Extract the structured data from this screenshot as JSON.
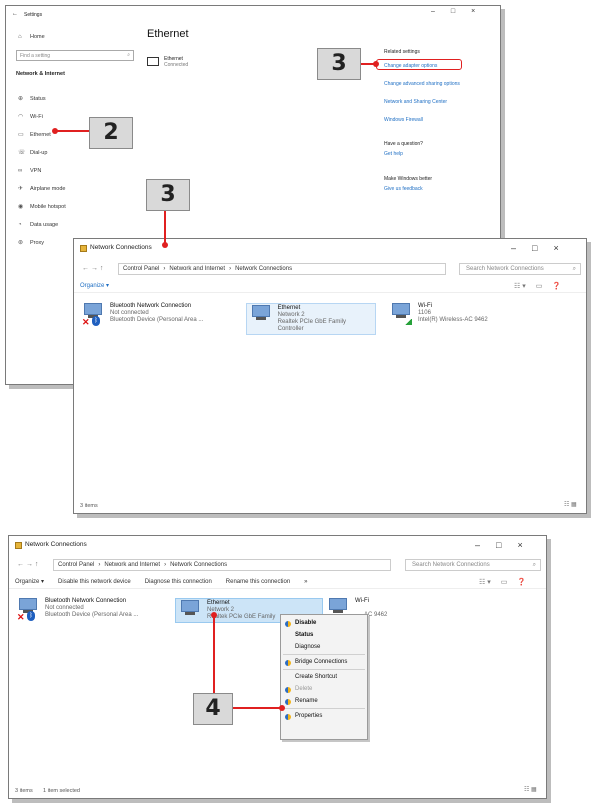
{
  "settings": {
    "title": "Settings",
    "back_glyph": "←",
    "home": "Home",
    "search_placeholder": "Find a setting",
    "section": "Network & Internet",
    "nav": [
      {
        "label": "Status",
        "icon": "status-icon"
      },
      {
        "label": "Wi-Fi",
        "icon": "wifi-icon"
      },
      {
        "label": "Ethernet",
        "icon": "ethernet-icon"
      },
      {
        "label": "Dial-up",
        "icon": "dialup-icon"
      },
      {
        "label": "VPN",
        "icon": "vpn-icon"
      },
      {
        "label": "Airplane mode",
        "icon": "airplane-icon"
      },
      {
        "label": "Mobile hotspot",
        "icon": "hotspot-icon"
      },
      {
        "label": "Data usage",
        "icon": "data-usage-icon"
      },
      {
        "label": "Proxy",
        "icon": "proxy-icon"
      }
    ],
    "page_title": "Ethernet",
    "adapter_name": "Ethernet",
    "adapter_status": "Connected",
    "related_heading": "Related settings",
    "related_links": [
      "Change adapter options",
      "Change advanced sharing options",
      "Network and Sharing Center",
      "Windows Firewall"
    ],
    "question_heading": "Have a question?",
    "question_link": "Get help",
    "better_heading": "Make Windows better",
    "better_link": "Give us feedback",
    "window_controls": [
      "–",
      "□",
      "×"
    ]
  },
  "netconn1": {
    "title": "Network Connections",
    "breadcrumb": [
      "Control Panel",
      "Network and Internet",
      "Network Connections"
    ],
    "nav_glyphs": "←  →  ↑",
    "search_placeholder": "Search Network Connections",
    "organize": "Organize ▾",
    "window_controls": [
      "–",
      "□",
      "×"
    ],
    "items": [
      {
        "name": "Bluetooth Network Connection",
        "line2": "Not connected",
        "line3": "Bluetooth Device (Personal Area ..."
      },
      {
        "name": "Ethernet",
        "line2": "Network 2",
        "line3": "Realtek PCIe GbE Family Controller"
      },
      {
        "name": "Wi-Fi",
        "line2": "1106",
        "line3": "Intel(R) Wireless-AC 9462"
      }
    ],
    "status": "3 items"
  },
  "netconn2": {
    "title": "Network Connections",
    "breadcrumb": [
      "Control Panel",
      "Network and Internet",
      "Network Connections"
    ],
    "nav_glyphs": "←  →  ↑",
    "search_placeholder": "Search Network Connections",
    "toolbar": [
      "Organize ▾",
      "Disable this network device",
      "Diagnose this connection",
      "Rename this connection",
      "»"
    ],
    "window_controls": [
      "–",
      "□",
      "×"
    ],
    "items": [
      {
        "name": "Bluetooth Network Connection",
        "line2": "Not connected",
        "line3": "Bluetooth Device (Personal Area ..."
      },
      {
        "name": "Ethernet",
        "line2": "Network 2",
        "line3": "Realtek PCIe GbE Family"
      },
      {
        "name": "Wi-Fi",
        "line2": "",
        "line3": "AC 9462"
      }
    ],
    "context_menu": [
      "Disable",
      "Status",
      "Diagnose",
      "Bridge Connections",
      "Create Shortcut",
      "Delete",
      "Rename",
      "Properties"
    ],
    "status_count": "3 items",
    "status_selected": "1 item selected"
  },
  "callouts": {
    "two": "2",
    "three_a": "3",
    "three_b": "3",
    "four": "4"
  },
  "colors": {
    "accent": "#1f6fc4",
    "highlight": "#e02020",
    "selection": "#cce4f7"
  }
}
